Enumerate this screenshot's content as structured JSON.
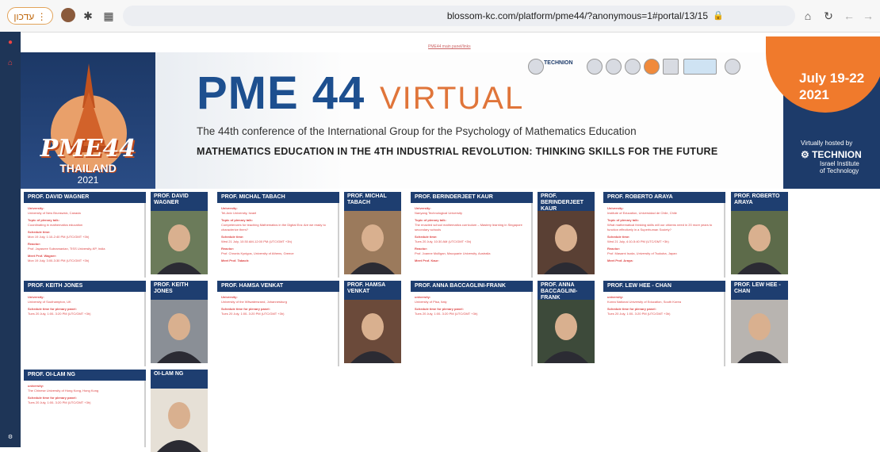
{
  "browser": {
    "update_label": "עדכון",
    "url": "blossom-kc.com/platform/pme44/?anonymous=1#portal/13/15"
  },
  "nav": {
    "link": "PME44 main panel/links"
  },
  "banner": {
    "logo_text": "PME44",
    "logo_sub": "THAILAND",
    "logo_year": "2021",
    "title": "PME 44",
    "virtual": "VIRTUAL",
    "conference": "The 44th conference of the International Group for the Psychology of Mathematics Education",
    "theme": "MATHEMATICS EDUCATION IN THE 4TH INDUSTRIAL REVOLUTION: THINKING SKILLS FOR THE FUTURE",
    "dates_line1": "July 19-22",
    "dates_line2": "2021",
    "hosted": "Virtually hosted by",
    "technion": "TECHNION",
    "technion_sub1": "Israel Institute",
    "technion_sub2": "of Technology",
    "sponsor_tech": "TECHNION"
  },
  "cards": [
    {
      "name": "PROF. DAVID WAGNER",
      "photo_name": "PROF. DAVID WAGNER",
      "uni_label": "University:",
      "uni": "University of New Brunswick, Canada",
      "topic_label": "Topic of plenary talk:",
      "topic": "Coordinating in mathematics education",
      "time_label": "Schedule time:",
      "time": "Mon 19 July, 1:10-2:40 PM (UTC/GMT +3h)",
      "reactor_label": "Reactor:",
      "reactor": "Prof. Jayasree Subramanian, TISS University-KP, India",
      "meet_label": "Meet Prof. Wagner:",
      "meet": "Mon 19 July, 3:00-3:30 PM (UTC/GMT +3h)"
    },
    {
      "name": "PROF. MICHAL TABACH",
      "photo_name": "PROF. MICHAL TABACH",
      "uni_label": "University:",
      "uni": "Tel-Aviv University, Israel",
      "topic_label": "Topic of plenary talk:",
      "topic": "Competencies for teaching Mathematics in the Digital Era: Are we ready to characterize them?",
      "time_label": "Schedule time:",
      "time": "Wed 21 July, 10:30 AM-12:00 PM (UTC/GMT +3h)",
      "reactor_label": "Reactor:",
      "reactor": "Prof. Chronis Kynigos, University of Athens, Greece",
      "meet_label": "Meet Prof. Tabach:",
      "meet": ""
    },
    {
      "name": "PROF. BERINDERJEET KAUR",
      "photo_name": "PROF. BERINDERJEET KAUR",
      "uni_label": "University:",
      "uni": "Nanyang Technological University",
      "topic_label": "Topic of plenary talk:",
      "topic": "The enacted school mathematics curriculum – Mastery learning in Singapore secondary schools",
      "time_label": "Schedule time:",
      "time": "Tues 20 July, 10:30 AM (UTC/GMT +3h)",
      "reactor_label": "Reactor:",
      "reactor": "Prof. Joanne Mulligan, Macquarie University, Australia",
      "meet_label": "Meet Prof. Kaur:",
      "meet": ""
    },
    {
      "name": "PROF. ROBERTO ARAYA",
      "photo_name": "PROF. ROBERTO ARAYA",
      "uni_label": "University:",
      "uni": "Institute of Education, Universidad de Chile, Chile",
      "topic_label": "Topic of plenary talk:",
      "topic": "What mathematical thinking skills will our citizens need in 20 more years to function effectively in a Superhuman Society?",
      "time_label": "Schedule time:",
      "time": "Wed 21 July, 4:10-5:40 PM (UTC/GMT +3h)",
      "reactor_label": "Reactor:",
      "reactor": "Prof. Masami Isoda, University of Tsukuba, Japan",
      "meet_label": "Meet Prof. Araya:",
      "meet": ""
    },
    {
      "name": "PROF. KEITH JONES",
      "photo_name": "PROF. KEITH JONES",
      "uni_label": "University:",
      "uni": "University of Southampton, UK",
      "time_label": "Schedule time for plenary panel:",
      "time": "Tues 20 July, 1:00- 3:20 PM (UTC/GMT +3h)"
    },
    {
      "name": "PROF. HAMSA VENKAT",
      "photo_name": "PROF. HAMSA VENKAT",
      "uni_label": "University:",
      "uni": "University of the Witwatersrand, Johannesburg",
      "time_label": "Schedule time for plenary panel:",
      "time": "Tues 20 July, 1:00- 3:20 PM (UTC/GMT +3h)"
    },
    {
      "name": "PROF. ANNA BACCAGLINI-FRANK",
      "photo_name": "PROF. ANNA BACCAGLINI-FRANK",
      "uni_label": "university:",
      "uni": "University of Pisa, Italy",
      "time_label": "Schedule time for plenary panel:",
      "time": "Tues 20 July, 1:00- 3:20 PM (UTC/GMT +3h)"
    },
    {
      "name": "PROF. LEW HEE - CHAN",
      "photo_name": "PROF. LEW HEE - CHAN",
      "uni_label": "university:",
      "uni": "Korea National University of Education, South Korea",
      "time_label": "Schedule time for plenary panel:",
      "time": "Tues 20 July, 1:00- 3:20 PM (UTC/GMT +3h)"
    },
    {
      "name": "PROF. OI-LAM NG",
      "photo_name": "OI-LAM NG",
      "uni_label": "university:",
      "uni": "The Chinese University of Hong Kong, Hong Kong",
      "time_label": "Schedule time for plenary panel:",
      "time": "Tues 20 July, 1:00- 3:20 PM (UTC/GMT +3h)"
    }
  ]
}
